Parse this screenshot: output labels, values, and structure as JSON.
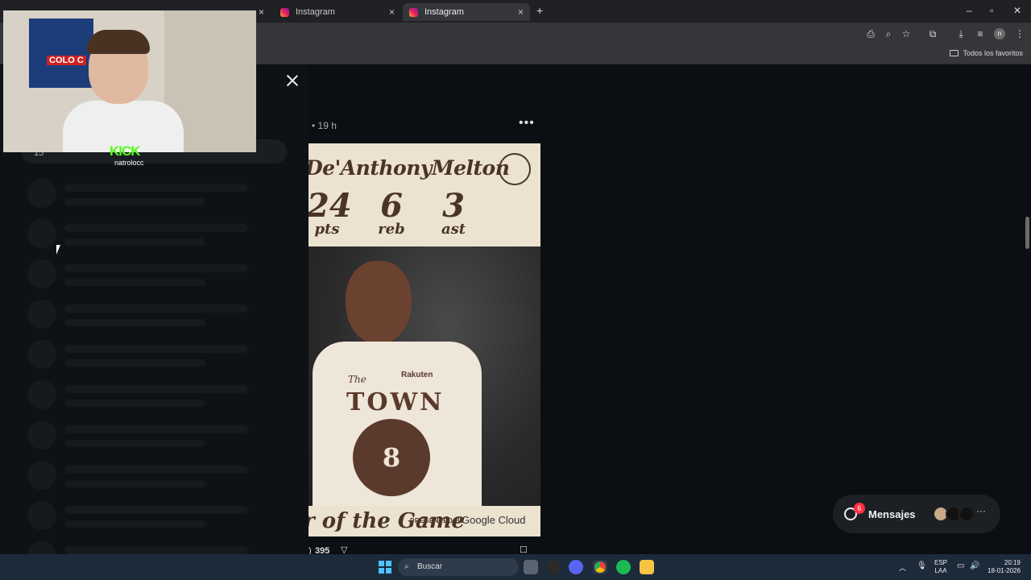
{
  "browser": {
    "tabs": [
      {
        "label": "",
        "active": false
      },
      {
        "label": "Instagram",
        "active": false
      },
      {
        "label": "Instagram",
        "active": true
      }
    ],
    "new_tab_symbol": "+",
    "close_symbol": "×",
    "bookmarks": {
      "all_favorites": "Todos los favoritos"
    }
  },
  "modal": {
    "close_symbol": "",
    "post_time": "• 19 h",
    "more_symbol": "•••",
    "left_list": {
      "active_count": "15"
    }
  },
  "post": {
    "player_name": "De'AnthonyMelton",
    "stats": [
      {
        "value": "24",
        "unit": "pts"
      },
      {
        "value": "6",
        "unit": "reb"
      },
      {
        "value": "3",
        "unit": "ast"
      }
    ],
    "jersey_text": "TOWN",
    "jersey_small": "The",
    "jersey_number": "8",
    "sponsor": "Rakuten",
    "footer_game": "r of the Game",
    "presented_by": "PRESENTED BY",
    "sponsor_footer": "Google Cloud",
    "likes": "395"
  },
  "messages": {
    "label": "Mensajes",
    "badge": "6",
    "more_symbol": "···"
  },
  "webcam": {
    "flag_text": "COLO C",
    "kick_logo": "KICK",
    "kick_user": "natrolocc"
  },
  "taskbar": {
    "search_placeholder": "Buscar",
    "lang_top": "ESP",
    "lang_bottom": "LAA",
    "time": "20:19",
    "date": "18-01-2026"
  },
  "colors": {
    "accent_badge": "#ff3040",
    "kick_green": "#53fc18",
    "page_bg": "#0b0f13"
  }
}
